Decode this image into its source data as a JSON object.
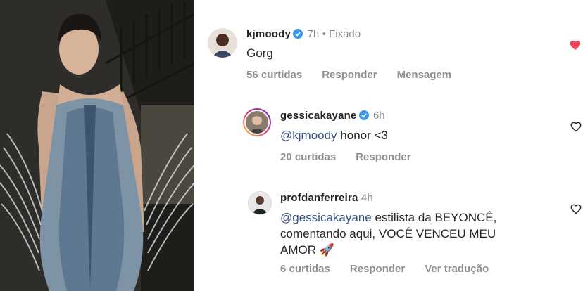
{
  "comments": [
    {
      "username": "kjmoody",
      "time": "7h",
      "pinned": "• Fixado",
      "text": "Gorg",
      "likes": "56 curtidas",
      "reply": "Responder",
      "message": "Mensagem",
      "liked": true
    },
    {
      "username": "gessicakayane",
      "time": "6h",
      "mention": "@kjmoody",
      "text": " honor <3",
      "likes": "20 curtidas",
      "reply": "Responder",
      "liked": false
    },
    {
      "username": "profdanferreira",
      "time": "4h",
      "mention": "@gessicakayane",
      "text_line1": " estilista da BEYONCÊ,",
      "text_line2": "comentando aqui, VOCÊ VENCEU MEU",
      "text_line3": "AMOR 🚀",
      "likes": "6 curtidas",
      "reply": "Responder",
      "translate": "Ver tradução",
      "liked": false
    }
  ],
  "colors": {
    "heart_liked": "#ed4956",
    "verified": "#3897f0",
    "mention": "#385185",
    "muted": "#8e8e8e"
  }
}
